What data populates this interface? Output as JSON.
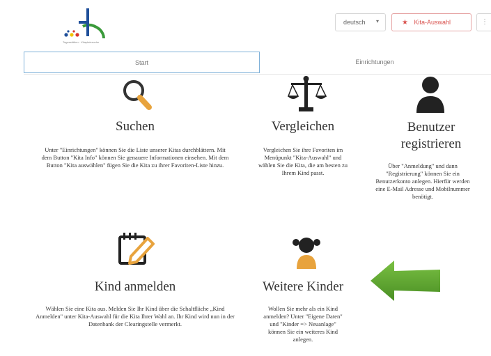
{
  "header": {
    "logo_caption": "Tagesstätten · Kitaplatzsuche",
    "language": "deutsch",
    "kita_button": "Kita-Auswahl",
    "more_button": "⋮",
    "colors": {
      "accent": "#d9534f",
      "tab_border": "#7eb0d8",
      "arrow": "#5aa530",
      "icon_orange": "#e8a33d"
    }
  },
  "tabs": [
    {
      "label": "Start"
    },
    {
      "label": "Einrichtungen"
    }
  ],
  "features": [
    {
      "icon": "search-icon",
      "title": "Suchen",
      "text": "Unter \"Einrichtungen\" können Sie die Liste unserer Kitas durchblättern. Mit dem Button \"Kita Info\" können Sie genauere Informationen einsehen. Mit dem Button \"Kita auswählen\" fügen Sie die Kita zu ihrer Favoriten-Liste hinzu."
    },
    {
      "icon": "scale-icon",
      "title": "Vergleichen",
      "text": "Vergleichen Sie ihre Favoriten im Menüpunkt \"Kita-Auswahl\" und wählen Sie die Kita, die am besten zu Ihrem Kind passt."
    },
    {
      "icon": "user-icon",
      "title": "Benutzer registrieren",
      "text": "Über \"Anmeldung\" und dann \"Registrierung\" können Sie ein Benutzerkonto anlegen. Hierfür werden eine E-Mail Adresse und Mobilnummer benötigt."
    },
    {
      "icon": "notepad-pencil-icon",
      "title": "Kind anmelden",
      "text": "Wählen Sie eine Kita aus. Melden Sie Ihr Kind über die Schaltfläche „Kind Anmelden\" unter Kita-Auswahl für die Kita Ihrer Wahl an. Ihr Kind wird nun in der Datenbank der Clearingstelle vermerkt."
    },
    {
      "icon": "child-icon",
      "title": "Weitere Kinder",
      "text": "Wollen Sie mehr als ein Kind anmelden? Unter \"Eigene Daten\" und \"Kinder => Neuanlage\" können Sie ein weiteres Kind anlegen."
    }
  ]
}
